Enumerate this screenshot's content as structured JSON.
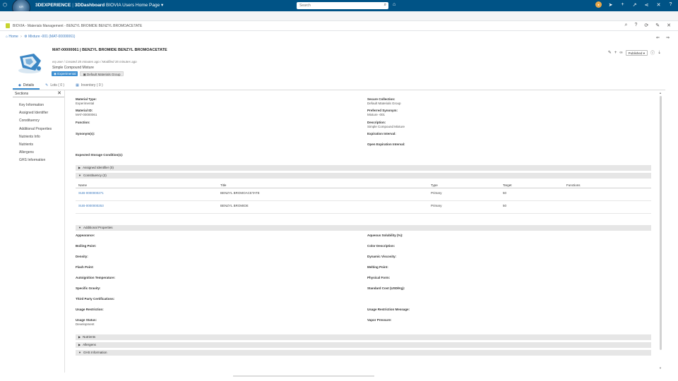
{
  "topbar": {
    "compass_label": "V.R",
    "brand_bold": "3DEXPERIENCE",
    "brand_section": "3DDashboard",
    "dashboard": "BIOVIA Users Home Page",
    "search_placeholder": "Search"
  },
  "app": {
    "title": "BIOVIA - Materials Management - BENZYL BROMIDE BENZYL BROMOACETATE"
  },
  "breadcrumb": {
    "home": "Home",
    "current": "Mixture -001 (MAT-00000061)"
  },
  "object": {
    "title": "MAT-00000061 | BENZYL BROMIDE BENZYL BROMOACETATE",
    "meta": "eq user / Created 35 minutes ago / Modified 35 minutes ago",
    "description": "Simple Compound Mixture",
    "chip_status": "Experimental",
    "chip_group": "Default Materials Group",
    "maturity": "Published"
  },
  "tabs": [
    {
      "label": "Details"
    },
    {
      "label": "Lots ( 0 )"
    },
    {
      "label": "Inventory ( 0 )"
    }
  ],
  "sidepanel": {
    "heading": "Sections",
    "items": [
      "Key Information",
      "Assigned Identifier",
      "Constituency",
      "Additional Properties",
      "Nutrients Info",
      "Nutrients",
      "Allergens",
      "GHS Information"
    ]
  },
  "key_info": {
    "material_type_label": "Material Type:",
    "material_type_value": "Experimental",
    "material_id_label": "Material ID:",
    "material_id_value": "MAT-00000061",
    "function_label": "Function:",
    "synonyms_label": "Synonym(s):",
    "storage_label": "Expected Storage Condition(s):",
    "secure_collection_label": "Secure Collection:",
    "secure_collection_value": "Default Materials Group",
    "preferred_synonym_label": "Preferred Synonym:",
    "preferred_synonym_value": "Mixture -001",
    "description_label": "Description:",
    "description_value": "Simple Compound Mixture",
    "expiration_label": "Expiration Interval:",
    "open_expiration_label": "Open Expiration Interval:"
  },
  "sections": {
    "assigned_identifier": "Assigned Identifier (0)",
    "constituency": "Constituency (2)",
    "additional_properties": "Additional Properties",
    "nutrients": "Nutrients",
    "allergens": "Allergens",
    "ghs": "GHS Information"
  },
  "constituency_table": {
    "headers": [
      "Name",
      "Title",
      "Type",
      "Target",
      "Functions"
    ],
    "rows": [
      {
        "name": "SUB-0000000271",
        "title": "BENZYL BROMOACETATE",
        "type": "Primary",
        "target": "50",
        "functions": ""
      },
      {
        "name": "SUB-0000000253",
        "title": "BENZYL BROMIDE",
        "type": "Primary",
        "target": "50",
        "functions": ""
      }
    ]
  },
  "additional_props": {
    "left": [
      "Appearance:",
      "Boiling Point:",
      "Density:",
      "Flash Point:",
      "Autoignition Temperature:",
      "Specific Gravity:",
      "Third Party Certifications:",
      "Usage Restriction:",
      "Usage Status:"
    ],
    "usage_status_value": "Development",
    "right": [
      "Aqueous Solubility (%):",
      "Color Description:",
      "Dynamic Viscosity:",
      "Melting Point:",
      "Physical Form:",
      "Standard Cost (USD/Kg):",
      "",
      "Usage Restriction Message:",
      "Vapor Pressure:"
    ]
  },
  "colors": {
    "topbar": "#005386",
    "accent": "#3d8fd1",
    "link": "#3d7bbf"
  }
}
